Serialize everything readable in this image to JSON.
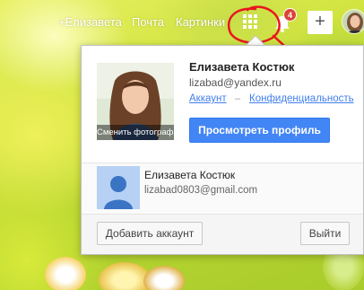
{
  "topbar": {
    "user_link": "+Елизавета",
    "mail_link": "Почта",
    "images_link": "Картинки",
    "notifications_count": "4",
    "plus_label": "+"
  },
  "account": {
    "name": "Елизавета Костюк",
    "email": "lizabad@yandex.ru",
    "account_link": "Аккаунт",
    "separator": "–",
    "privacy_link": "Конфиденциальность",
    "change_photo": "Сменить фотографию",
    "view_profile_button": "Просмотреть профиль"
  },
  "other_account": {
    "name": "Елизавета Костюк",
    "email": "lizabad0803@gmail.com"
  },
  "footer": {
    "add_account_button": "Добавить аккаунт",
    "sign_out_button": "Выйти"
  },
  "colors": {
    "primary_button": "#4285f4",
    "link": "#427fed",
    "badge": "#db4437",
    "annotation": "#e8161e"
  }
}
